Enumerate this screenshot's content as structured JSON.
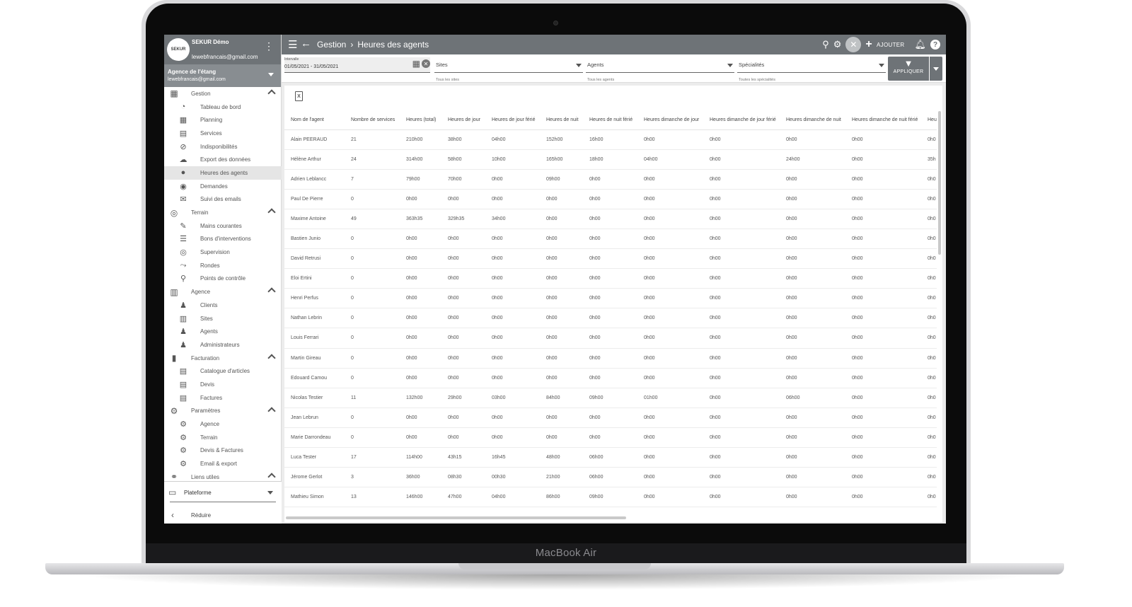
{
  "device": {
    "brand": "MacBook Air"
  },
  "profile": {
    "avatar_text": "SEKUR",
    "name": "SEKUR Démo",
    "email": "lewebfrancais@gmail.com"
  },
  "agency": {
    "name": "Agence de l'étang",
    "email": "lewebfrancais@gmail.com"
  },
  "nav": {
    "gestion": {
      "label": "Gestion",
      "items": [
        "Tableau de bord",
        "Planning",
        "Services",
        "Indisponibilités",
        "Export des données",
        "Heures des agents",
        "Demandes",
        "Suivi des emails"
      ]
    },
    "terrain": {
      "label": "Terrain",
      "items": [
        "Mains courantes",
        "Bons d'interventions",
        "Supervision",
        "Rondes",
        "Points de contrôle"
      ]
    },
    "agence": {
      "label": "Agence",
      "items": [
        "Clients",
        "Sites",
        "Agents",
        "Administrateurs"
      ]
    },
    "facturation": {
      "label": "Facturation",
      "items": [
        "Catalogue d'articles",
        "Devis",
        "Factures"
      ]
    },
    "parametres": {
      "label": "Paramètres",
      "items": [
        "Agence",
        "Terrain",
        "Devis & Factures",
        "Email & export"
      ]
    },
    "liens": {
      "label": "Liens utiles"
    }
  },
  "sidebar_bottom": {
    "platform": "Plateforme",
    "reduce": "Réduire"
  },
  "topbar": {
    "crumb_parent": "Gestion",
    "crumb_current": "Heures des agents",
    "add_label": "AJOUTER"
  },
  "filters": {
    "interval_caption": "Intervalle",
    "interval_value": "01/05/2021 - 31/05/2021",
    "sites_label": "Sites",
    "sites_hint": "Tous les sites",
    "agents_label": "Agents",
    "agents_hint": "Tous les agents",
    "specialites_label": "Spécialités",
    "specialites_hint": "Toutes les spécialités",
    "apply_label": "APPLIQUER"
  },
  "table": {
    "columns": [
      "Nom de l'agent",
      "Nombre de services",
      "Heures (total)",
      "Heures de jour",
      "Heures de jour férié",
      "Heures de nuit",
      "Heures de nuit férié",
      "Heures dimanche de jour",
      "Heures dimanche de jour férié",
      "Heures dimanche de nuit",
      "Heures dimanche de nuit férié",
      "Heu"
    ],
    "rows": [
      [
        "Alain PEERAUD",
        "21",
        "210h00",
        "38h00",
        "04h00",
        "152h00",
        "16h00",
        "0h00",
        "0h00",
        "0h00",
        "0h00",
        "0h0"
      ],
      [
        "Hélène Arthur",
        "24",
        "314h00",
        "58h00",
        "10h00",
        "165h00",
        "18h00",
        "04h00",
        "0h00",
        "24h00",
        "0h00",
        "35h"
      ],
      [
        "Adrien Leblancc",
        "7",
        "79h00",
        "70h00",
        "0h00",
        "09h00",
        "0h00",
        "0h00",
        "0h00",
        "0h00",
        "0h00",
        "0h0"
      ],
      [
        "Paul De Pierre",
        "0",
        "0h00",
        "0h00",
        "0h00",
        "0h00",
        "0h00",
        "0h00",
        "0h00",
        "0h00",
        "0h00",
        "0h0"
      ],
      [
        "Maxime Antoine",
        "49",
        "363h35",
        "329h35",
        "34h00",
        "0h00",
        "0h00",
        "0h00",
        "0h00",
        "0h00",
        "0h00",
        "0h0"
      ],
      [
        "Bastien Junio",
        "0",
        "0h00",
        "0h00",
        "0h00",
        "0h00",
        "0h00",
        "0h00",
        "0h00",
        "0h00",
        "0h00",
        "0h0"
      ],
      [
        "David Retrusi",
        "0",
        "0h00",
        "0h00",
        "0h00",
        "0h00",
        "0h00",
        "0h00",
        "0h00",
        "0h00",
        "0h00",
        "0h0"
      ],
      [
        "Eloi Ertini",
        "0",
        "0h00",
        "0h00",
        "0h00",
        "0h00",
        "0h00",
        "0h00",
        "0h00",
        "0h00",
        "0h00",
        "0h0"
      ],
      [
        "Henri Perfus",
        "0",
        "0h00",
        "0h00",
        "0h00",
        "0h00",
        "0h00",
        "0h00",
        "0h00",
        "0h00",
        "0h00",
        "0h0"
      ],
      [
        "Nathan Lebrin",
        "0",
        "0h00",
        "0h00",
        "0h00",
        "0h00",
        "0h00",
        "0h00",
        "0h00",
        "0h00",
        "0h00",
        "0h0"
      ],
      [
        "Louis Ferrari",
        "0",
        "0h00",
        "0h00",
        "0h00",
        "0h00",
        "0h00",
        "0h00",
        "0h00",
        "0h00",
        "0h00",
        "0h0"
      ],
      [
        "Martin Gireau",
        "0",
        "0h00",
        "0h00",
        "0h00",
        "0h00",
        "0h00",
        "0h00",
        "0h00",
        "0h00",
        "0h00",
        "0h0"
      ],
      [
        "Edouard Camou",
        "0",
        "0h00",
        "0h00",
        "0h00",
        "0h00",
        "0h00",
        "0h00",
        "0h00",
        "0h00",
        "0h00",
        "0h0"
      ],
      [
        "Nicolas Testier",
        "11",
        "132h00",
        "29h00",
        "03h00",
        "84h00",
        "09h00",
        "01h00",
        "0h00",
        "06h00",
        "0h00",
        "0h0"
      ],
      [
        "Jean Lebrun",
        "0",
        "0h00",
        "0h00",
        "0h00",
        "0h00",
        "0h00",
        "0h00",
        "0h00",
        "0h00",
        "0h00",
        "0h0"
      ],
      [
        "Marie Darrondeau",
        "0",
        "0h00",
        "0h00",
        "0h00",
        "0h00",
        "0h00",
        "0h00",
        "0h00",
        "0h00",
        "0h00",
        "0h0"
      ],
      [
        "Luca Tester",
        "17",
        "114h00",
        "43h15",
        "16h45",
        "48h00",
        "06h00",
        "0h00",
        "0h00",
        "0h00",
        "0h00",
        "0h0"
      ],
      [
        "Jérome Gerlot",
        "3",
        "36h00",
        "08h30",
        "00h30",
        "21h00",
        "06h00",
        "0h00",
        "0h00",
        "0h00",
        "0h00",
        "0h0"
      ],
      [
        "Mathieu Simon",
        "13",
        "146h00",
        "47h00",
        "04h00",
        "86h00",
        "09h00",
        "0h00",
        "0h00",
        "0h00",
        "0h00",
        "0h0"
      ]
    ]
  }
}
